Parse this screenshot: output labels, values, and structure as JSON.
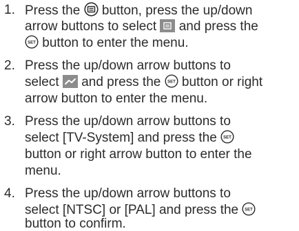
{
  "steps": [
    {
      "number": "1.",
      "lines": [
        [
          "Press the ",
          "{menu-button-icon}",
          " button, press the up/down"
        ],
        [
          "arrow buttons to select ",
          "{menu-tab-icon}",
          " and press the"
        ],
        [
          "{set-button-icon}",
          " button to enter the menu."
        ]
      ]
    },
    {
      "number": "2.",
      "lines": [
        [
          "Press the up/down arrow buttons to"
        ],
        [
          "select ",
          "{settings-tab-icon}",
          " and press the ",
          "{set-button-icon}",
          " button or right"
        ],
        [
          "arrow button to enter the menu."
        ]
      ]
    },
    {
      "number": "3.",
      "lines": [
        [
          "Press the up/down arrow buttons to"
        ],
        [
          "select [TV-System] and press the ",
          "{set-button-icon}"
        ],
        [
          "button or right arrow button to enter the"
        ],
        [
          "menu."
        ]
      ]
    },
    {
      "number": "4.",
      "lines": [
        [
          "Press the up/down arrow buttons to"
        ],
        [
          "select [NTSC] or [PAL] and press the ",
          "{set-button-icon}"
        ],
        [
          "button to confirm."
        ]
      ]
    }
  ],
  "set_button_label": "SET",
  "colors": {
    "text": "#2b2b2b",
    "icon_fill": "#8c8c8c",
    "icon_dark": "#2b2b2b"
  }
}
